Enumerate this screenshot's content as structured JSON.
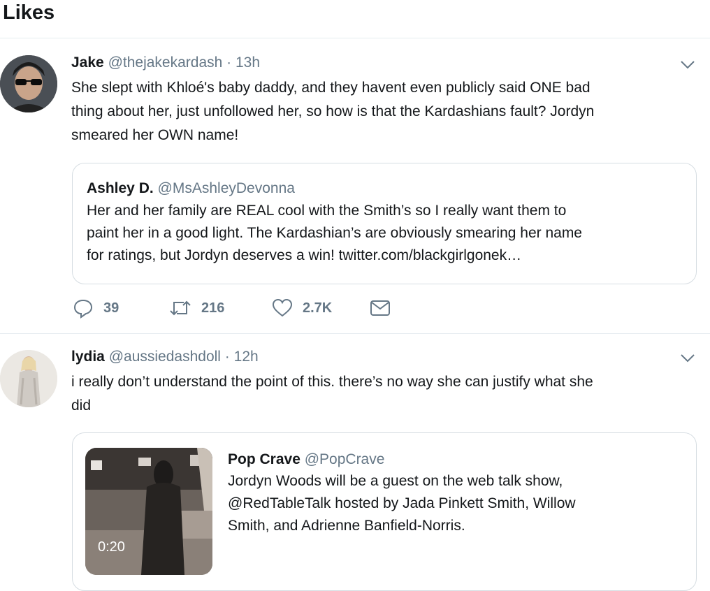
{
  "header": {
    "title": "Likes"
  },
  "tweets": [
    {
      "name": "Jake",
      "handle": "@thejakekardash",
      "time": "13h",
      "text_lines": [
        "She slept with Khloé's baby daddy, and they havent even publicly said ONE bad",
        "thing about her, just unfollowed her, so how is that the Kardashians fault? Jordyn",
        "smeared her OWN name!"
      ],
      "quote": {
        "name": "Ashley D.",
        "handle": "@MsAshleyDevonna",
        "text_lines": [
          "Her and her family are REAL cool with the Smith’s so I really want them to",
          "paint her in a good light. The Kardashian’s are obviously smearing her name",
          "for ratings, but Jordyn deserves a win! twitter.com/blackgirlgonek…"
        ]
      },
      "actions": {
        "replies": "39",
        "retweets": "216",
        "likes": "2.7K"
      }
    },
    {
      "name": "lydia",
      "handle": "@aussiedashdoll",
      "time": "12h",
      "text_lines": [
        "i really don’t understand the point of this. there’s no way she can justify what she",
        "did"
      ],
      "quote": {
        "name": "Pop Crave",
        "handle": "@PopCrave",
        "text_lines": [
          "Jordyn Woods will be a guest on the web talk show,",
          "@RedTableTalk hosted by Jada Pinkett Smith, Willow",
          "Smith, and Adrienne Banfield-Norris."
        ],
        "video_duration": "0:20"
      }
    }
  ],
  "separator": "·",
  "colors": {
    "text": "#14171a",
    "secondary": "#657786",
    "border": "#e6ecf0",
    "quote_border": "#d6dde2"
  },
  "icons": [
    "reply-icon",
    "retweet-icon",
    "like-icon",
    "direct-message-icon",
    "chevron-down-icon"
  ]
}
